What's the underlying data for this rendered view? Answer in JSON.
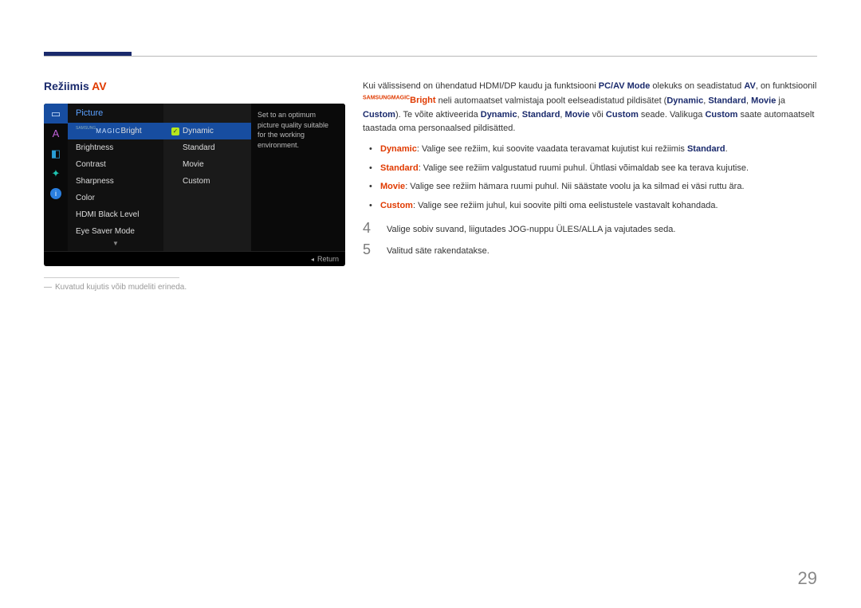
{
  "heading": {
    "text": "Režiimis ",
    "suffix": "AV"
  },
  "osd": {
    "section_title": "Picture",
    "magic_sup": "SAMSUNG",
    "magic_text": "MAGIC",
    "magic_suffix": "Bright",
    "items": [
      "Brightness",
      "Contrast",
      "Sharpness",
      "Color",
      "HDMI Black Level",
      "Eye Saver Mode"
    ],
    "options": [
      "Dynamic",
      "Standard",
      "Movie",
      "Custom"
    ],
    "help": "Set to an optimum picture quality suitable for the working environment.",
    "return": "Return",
    "down": "▼"
  },
  "footnote": {
    "dash": "―",
    "text": "Kuvatud kujutis võib mudeliti erineda."
  },
  "body": {
    "p1_a": "Kui välissisend on ühendatud HDMI/DP kaudu ja funktsiooni ",
    "p1_pcav": "PC/AV Mode",
    "p1_b": " olekuks on seadistatud ",
    "p1_av": "AV",
    "p1_c": ", on funktsioonil ",
    "mb_sup": "SAMSUNG",
    "mb_mag": "MAGIC",
    "mb_suf": "Bright",
    "p1_d": " neli automaatset valmistaja poolt eelseadistatud pildisätet (",
    "p1_dynamic": "Dynamic",
    "p1_sep": ", ",
    "p1_standard": "Standard",
    "p1_movie": "Movie",
    "p1_and": " ja ",
    "p1_custom": "Custom",
    "p1_e": "). Te võite aktiveerida ",
    "p1_f": " või ",
    "p1_g": " seade. Valikuga ",
    "p1_h": " saate automaatselt taastada oma personaalsed pildisätted.",
    "bullets": {
      "dyn_label": "Dynamic",
      "dyn_text": ": Valige see režiim, kui soovite vaadata teravamat kujutist kui režiimis ",
      "dyn_ref": "Standard",
      "dyn_end": ".",
      "std_label": "Standard",
      "std_text": ": Valige see režiim valgustatud ruumi puhul. Ühtlasi võimaldab see ka terava kujutise.",
      "mov_label": "Movie",
      "mov_text": ": Valige see režiim hämara ruumi puhul. Nii säästate voolu ja ka silmad ei väsi ruttu ära.",
      "cus_label": "Custom",
      "cus_text": ": Valige see režiim juhul, kui soovite pilti oma eelistustele vastavalt kohandada."
    },
    "step4": {
      "num": "4",
      "text": "Valige sobiv suvand, liigutades JOG-nuppu ÜLES/ALLA ja vajutades seda."
    },
    "step5": {
      "num": "5",
      "text": "Valitud säte rakendatakse."
    }
  },
  "page_number": "29"
}
